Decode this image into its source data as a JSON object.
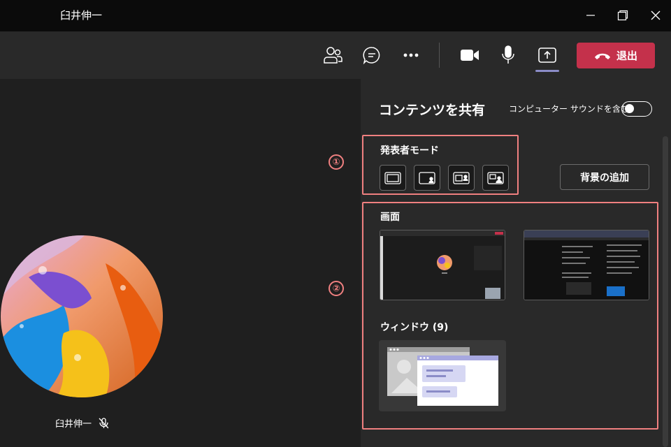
{
  "window": {
    "title": "臼井伸一",
    "controls": [
      "minimize-icon",
      "restore-icon",
      "close-icon"
    ]
  },
  "toolbar": {
    "icons": [
      "participants-icon",
      "chat-icon",
      "more-icon",
      "camera-icon",
      "microphone-icon",
      "share-icon"
    ],
    "leave_label": "退出",
    "leave_color": "#c4314b"
  },
  "stage": {
    "participant_name": "臼井伸一",
    "mic_status_icon": "mic-off-icon"
  },
  "share_panel": {
    "title": "コンテンツを共有",
    "include_sound_label": "コンピューター サウンドを含む",
    "include_sound_on": false,
    "presenter_mode_label": "発表者モード",
    "presenter_modes": [
      "content-only-icon",
      "standout-icon",
      "side-by-side-icon",
      "reporter-icon"
    ],
    "background_button": "背景の追加",
    "screen_label": "画面",
    "window_label": "ウィンドウ (9)"
  },
  "annotations": {
    "marker_1": "①",
    "marker_2": "②",
    "color": "#f08080"
  }
}
